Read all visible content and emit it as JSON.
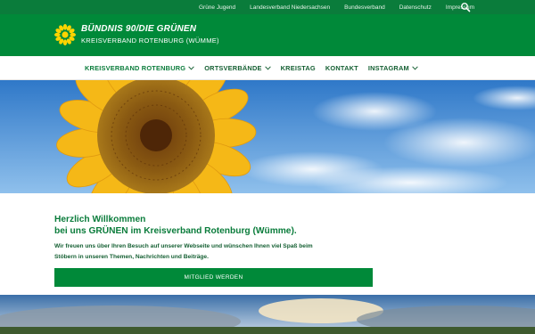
{
  "topbar": {
    "links": [
      "Grüne Jugend",
      "Landesverband Niedersachsen",
      "Bundesverband",
      "Datenschutz",
      "Impressum"
    ],
    "search_icon": "search-icon"
  },
  "brand": {
    "title": "BÜNDNIS 90/DIE GRÜNEN",
    "subtitle": "KREISVERBAND ROTENBURG (WÜMME)",
    "logo_icon": "sunflower-icon"
  },
  "nav": {
    "items": [
      {
        "label": "KREISVERBAND ROTENBURG",
        "has_dropdown": true
      },
      {
        "label": "ORTSVERBÄNDE",
        "has_dropdown": true
      },
      {
        "label": "KREISTAG",
        "has_dropdown": false
      },
      {
        "label": "KONTAKT",
        "has_dropdown": false
      },
      {
        "label": "INSTAGRAM",
        "has_dropdown": true
      }
    ]
  },
  "welcome": {
    "heading_line1": "Herzlich Willkommen",
    "heading_line2": "bei uns GRÜNEN im Kreisverband Rotenburg (Wümme).",
    "text": "Wir freuen uns über Ihren Besuch auf unserer Webseite und wünschen Ihnen viel Spaß beim Stöbern in unseren Themen, Nachrichten und Beiträge.",
    "button_label": "MITGLIED WERDEN"
  },
  "colors": {
    "green_dark": "#0a7c3b",
    "green": "#008939",
    "text_green": "#145f32",
    "sky": "#4f8fd4",
    "petal": "#f5b817"
  }
}
